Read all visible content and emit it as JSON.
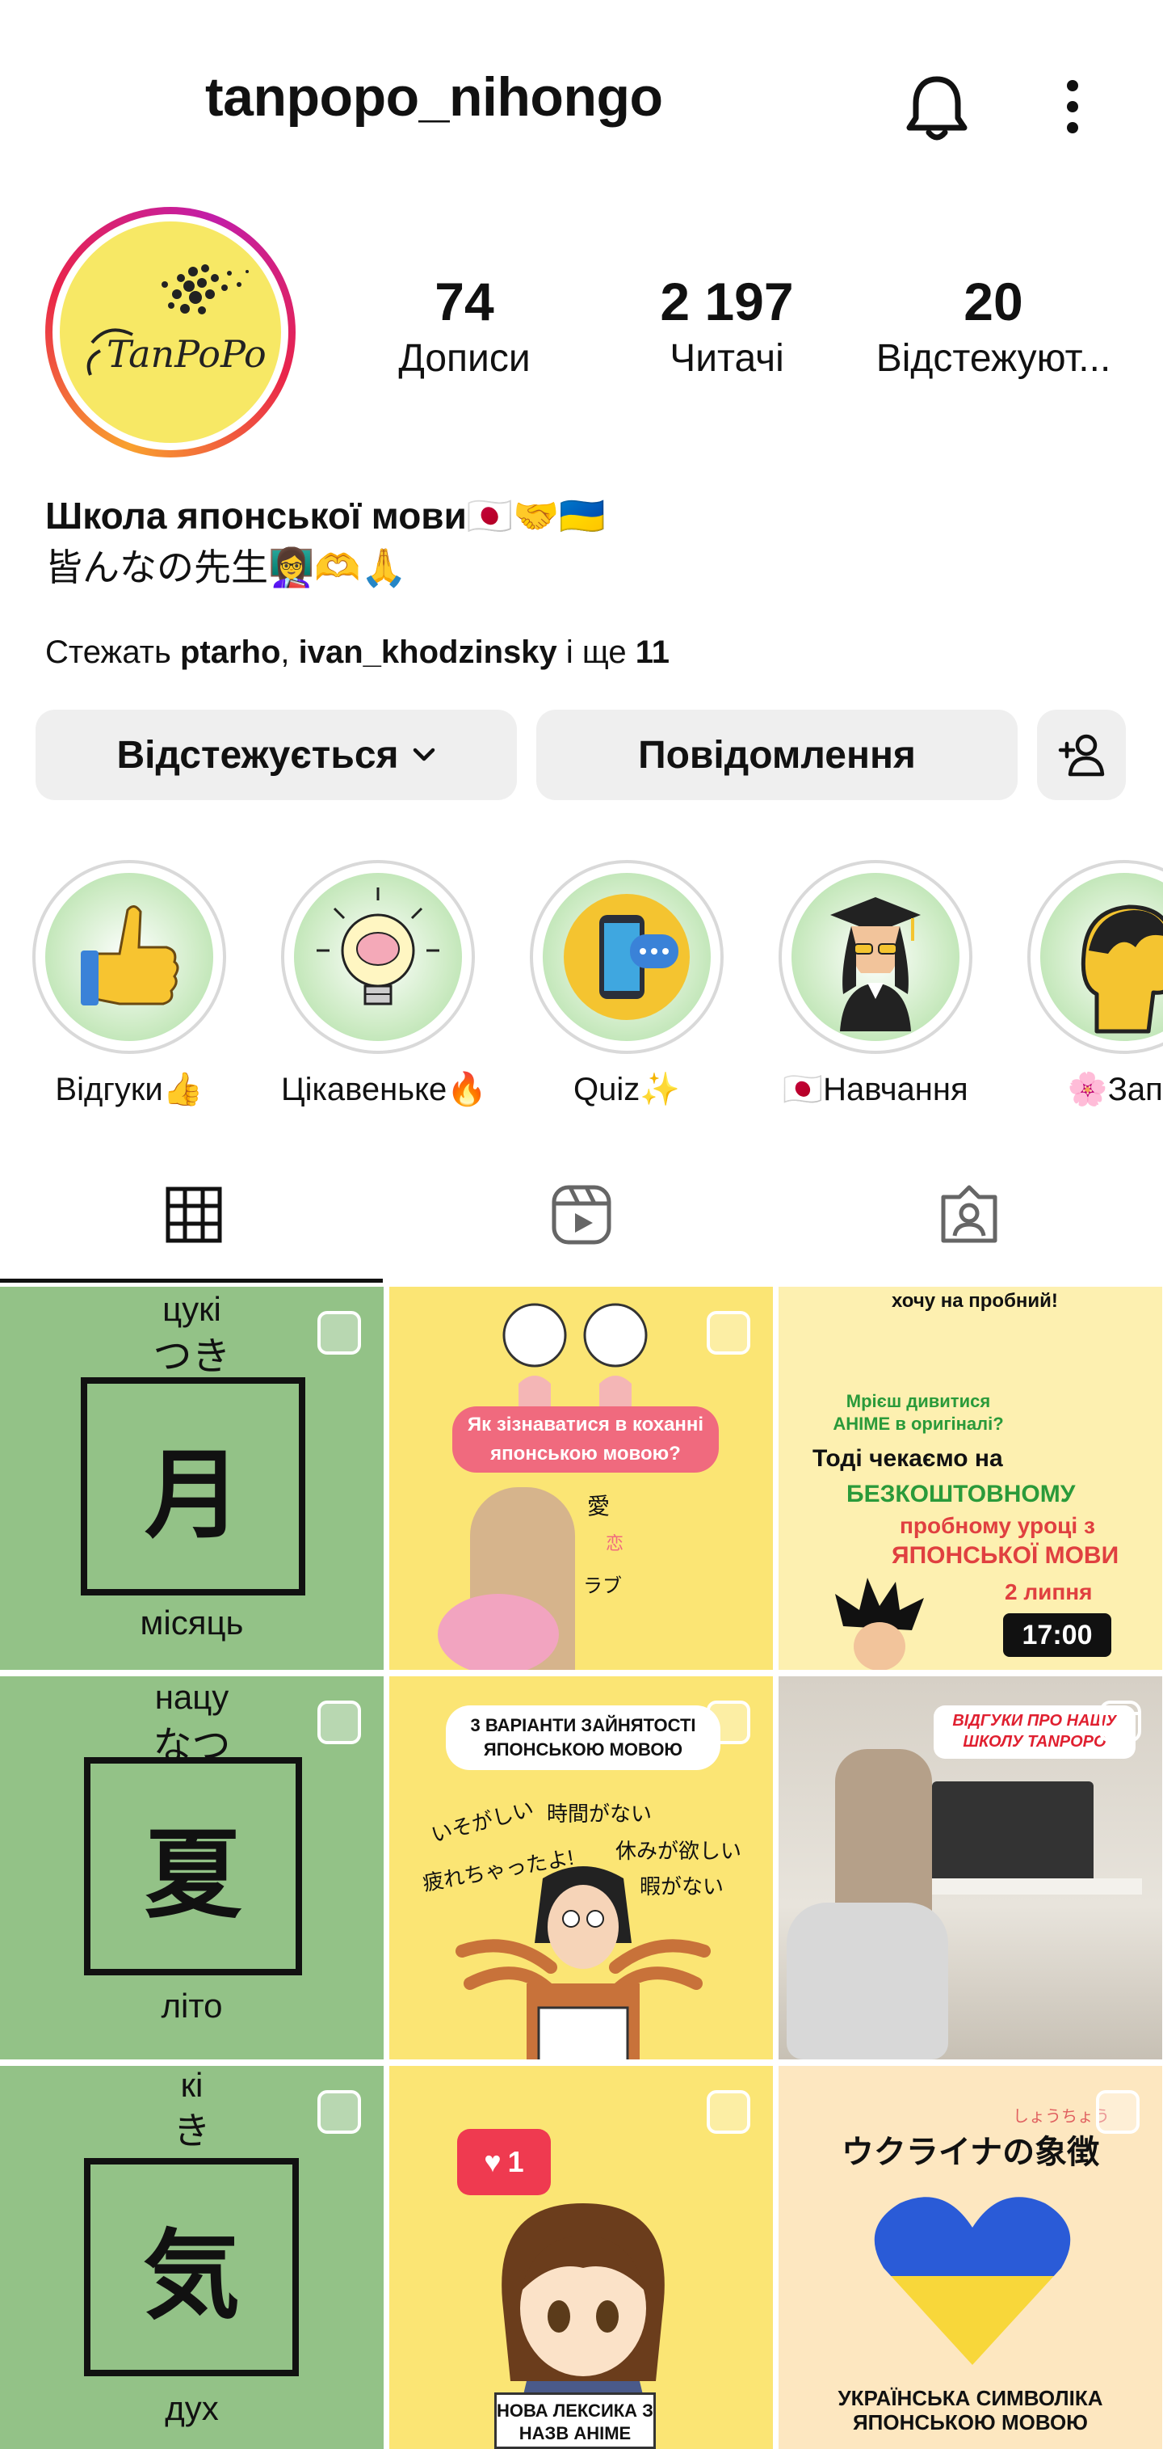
{
  "header": {
    "username": "tanpopo_nihongo"
  },
  "profile": {
    "avatar_text": "TanPoPo",
    "stats": [
      {
        "value": "74",
        "label": "Дописи"
      },
      {
        "value": "2 197",
        "label": "Читачі"
      },
      {
        "value": "20",
        "label": "Відстежуют..."
      }
    ],
    "bio_line1": "Школа японської мови🇯🇵🤝🇺🇦",
    "bio_line2": "皆んなの先生👩‍🏫🫶🙏",
    "followed_prefix": "Стежать ",
    "followed_user1": "ptarho",
    "followed_sep": ", ",
    "followed_user2": "ivan_khodzinsky",
    "followed_mid": " і ще ",
    "followed_count": "11"
  },
  "buttons": {
    "following": "Відстежується",
    "message": "Повідомлення"
  },
  "highlights": [
    {
      "label": "Відгуки👍",
      "icon": "thumbs-up-icon"
    },
    {
      "label": "Цікавеньке🔥",
      "icon": "lightbulb-brain-icon"
    },
    {
      "label": "Quiz✨",
      "icon": "phone-chat-icon"
    },
    {
      "label": "🇯🇵Навчання",
      "icon": "graduate-icon"
    },
    {
      "label": "🌸Запи",
      "icon": "head-profile-icon"
    }
  ],
  "tabs": [
    "grid-tab",
    "reels-tab",
    "tagged-tab"
  ],
  "posts": {
    "p1": {
      "romaji": "цукі",
      "kana": "つき",
      "kanji": "月",
      "meaning": "місяць"
    },
    "p2": {
      "title": "Як зізнаватися в коханні японською мовою?",
      "w1": "愛",
      "w2": "恋",
      "w3": "ラブ"
    },
    "p3": {
      "top": "хочу на пробний!",
      "q": "Мрієш дивитися АНІМЕ в оригіналі?",
      "l1": "Тоді чекаємо на",
      "l2": "БЕЗКОШТОВНОМУ",
      "l3": "пробному уроці з",
      "l4": "ЯПОНСЬКОЇ МОВИ",
      "date": "2 липня",
      "time": "17:00"
    },
    "p4": {
      "romaji": "нацу",
      "kana": "なつ",
      "kanji": "夏",
      "meaning": "літо"
    },
    "p5": {
      "title": "3 ВАРІАНТИ ЗАЙНЯТОСТІ ЯПОНСЬКОЮ МОВОЮ",
      "a": "いそがしい",
      "b": "時間がない",
      "c": "休みが欲しい",
      "d": "疲れちゃったよ!",
      "e": "暇がない"
    },
    "p6": {
      "title": "ВІДГУКИ ПРО НАШУ ШКОЛУ TANPOPO"
    },
    "p7": {
      "romaji": "кі",
      "kana": "き",
      "kanji": "気",
      "meaning": "дух"
    },
    "p8": {
      "likes": "1",
      "caption": "НОВА ЛЕКСИКА З НАЗВ АНІМЕ"
    },
    "p9": {
      "furigana": "しょうちょう",
      "title": "ウクライナの象徴",
      "caption": "УКРАЇНСЬКА СИМВОЛІКА ЯПОНСЬКОЮ МОВОЮ"
    }
  },
  "colors": {
    "green_tile": "#93c287",
    "yellow_tile": "#fbe574",
    "accent_pink": "#f06a7e",
    "ukraine_blue": "#2a5bd7",
    "ukraine_yellow": "#f8d73a"
  }
}
